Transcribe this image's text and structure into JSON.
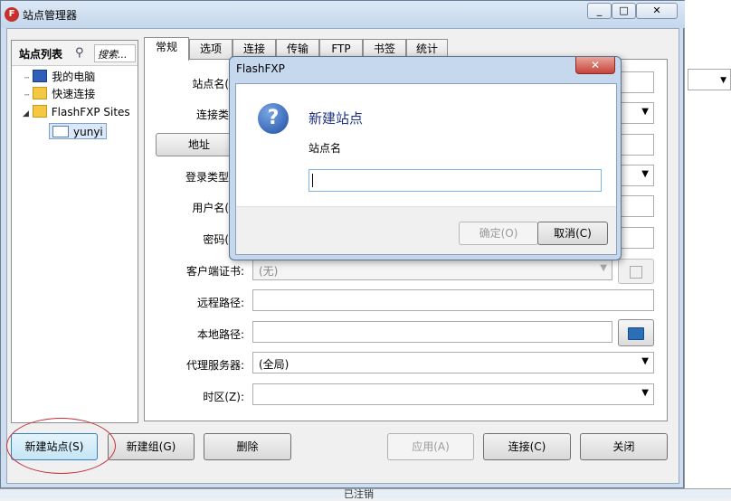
{
  "window": {
    "title": "站点管理器",
    "controls": {
      "minimize": "_",
      "maximize": "□",
      "close": "✕"
    }
  },
  "background_app": {
    "status_text": "已注销"
  },
  "site_tree": {
    "title": "站点列表",
    "search_placeholder": "搜索...",
    "items": [
      {
        "label": "我的电脑",
        "icon": "computer-icon"
      },
      {
        "label": "快速连接",
        "icon": "folder-icon"
      },
      {
        "label": "FlashFXP Sites",
        "icon": "folder-icon",
        "expanded": true
      },
      {
        "label": "yunyi",
        "icon": "site-icon",
        "selected": true
      }
    ]
  },
  "tabs": [
    {
      "label": "常规",
      "active": true
    },
    {
      "label": "选项"
    },
    {
      "label": "连接"
    },
    {
      "label": "传输"
    },
    {
      "label": "FTP"
    },
    {
      "label": "书签"
    },
    {
      "label": "统计"
    }
  ],
  "form": {
    "site_name_label": "站点名(",
    "connection_type_label": "连接类",
    "address_button": "地址",
    "login_type_label": "登录类型",
    "username_label": "用户名(",
    "password_label": "密码(",
    "client_cert_label": "客户端证书:",
    "client_cert_value": "(无)",
    "remote_path_label": "远程路径:",
    "local_path_label": "本地路径:",
    "proxy_label": "代理服务器:",
    "proxy_value": "(全局)",
    "timezone_label": "时区(Z):"
  },
  "buttons": {
    "new_site": "新建站点(S)",
    "new_group": "新建组(G)",
    "delete": "删除",
    "apply": "应用(A)",
    "connect": "连接(C)",
    "close": "关闭"
  },
  "dialog": {
    "title": "FlashFXP",
    "close": "✕",
    "heading": "新建站点",
    "field_label": "站点名",
    "input_value": "",
    "ok": "确定(O)",
    "cancel": "取消(C)"
  },
  "colors": {
    "dialog_heading": "#1e3287",
    "highlight_ellipse": "#c4303a",
    "accent": "#3c7fb1"
  }
}
